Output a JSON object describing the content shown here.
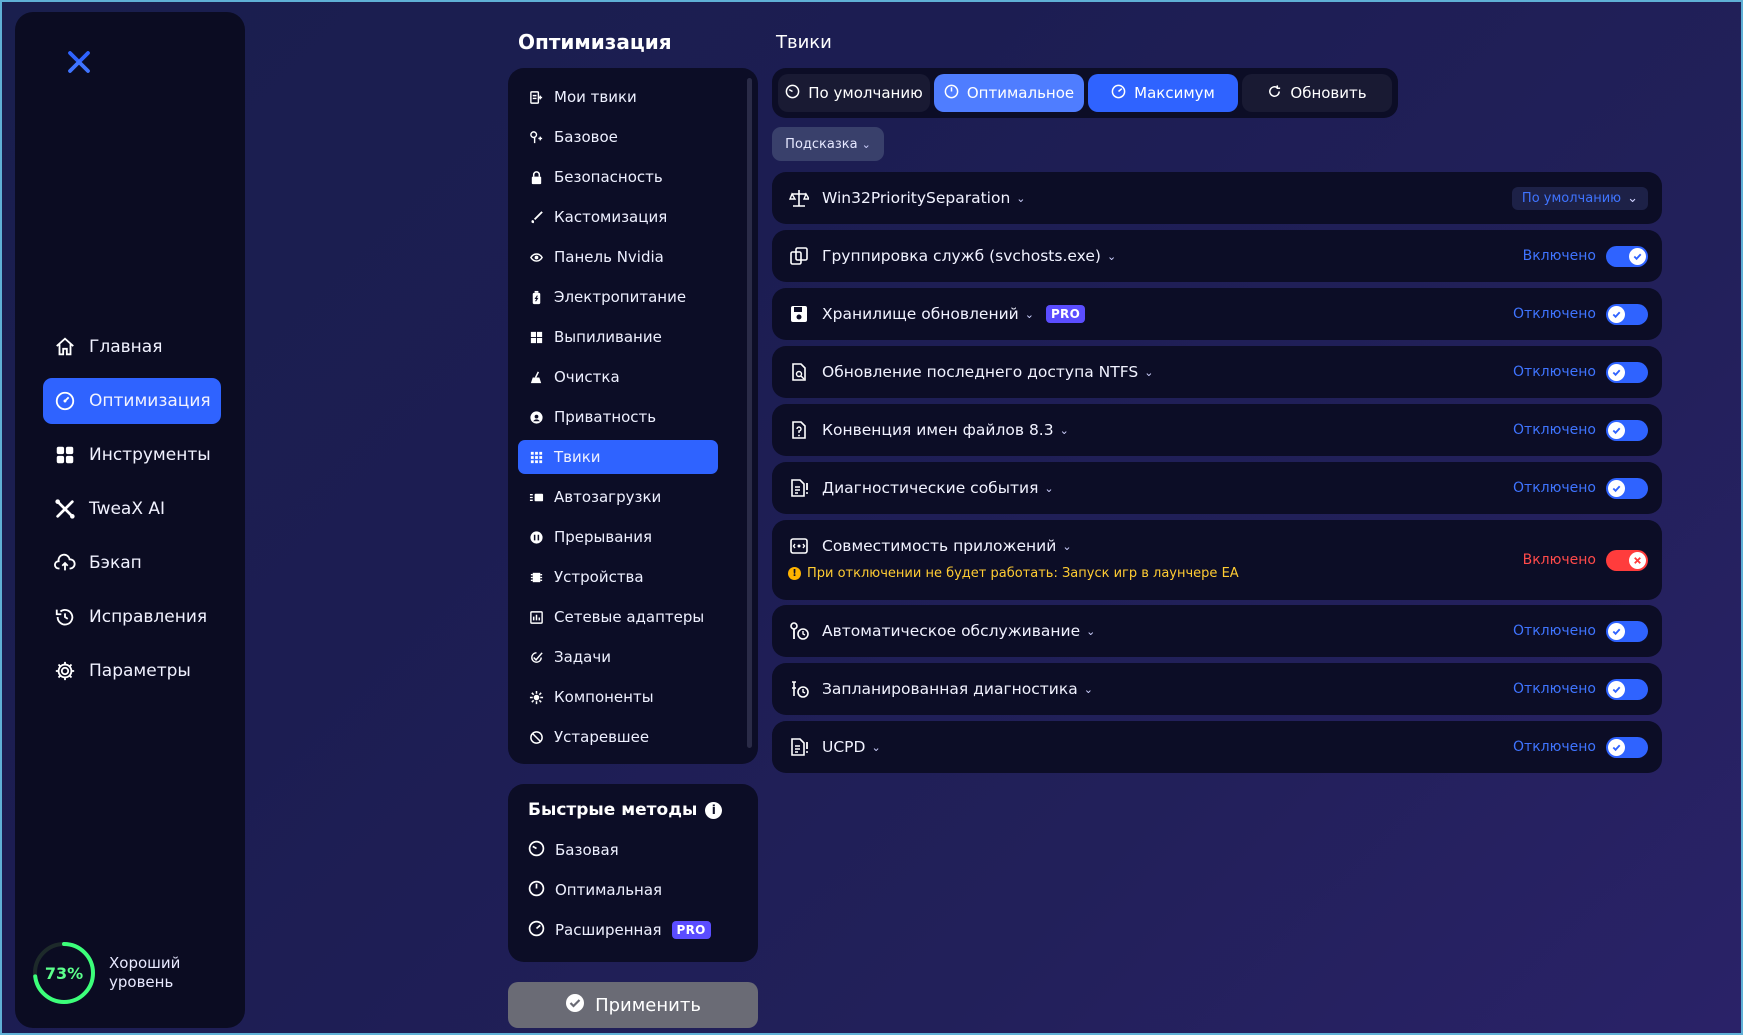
{
  "colors": {
    "accent": "#2f63ff",
    "accent_light": "#4f7dff",
    "panel": "#0c0d26",
    "status_blue": "#3f74ff",
    "status_red": "#ff4a4a",
    "level_green": "#5cff8c",
    "warning": "#ffcc33"
  },
  "sidebar": {
    "items": [
      {
        "label": "Главная",
        "icon": "home-icon"
      },
      {
        "label": "Оптимизация",
        "icon": "gauge-icon",
        "active": true
      },
      {
        "label": "Инструменты",
        "icon": "grid-icon"
      },
      {
        "label": "TweaX AI",
        "icon": "ai-icon"
      },
      {
        "label": "Бэкап",
        "icon": "cloud-upload-icon"
      },
      {
        "label": "Исправления",
        "icon": "history-icon"
      },
      {
        "label": "Параметры",
        "icon": "gear-icon"
      }
    ],
    "level": {
      "percent": "73%",
      "value": 0.73,
      "label": "Хороший уровень"
    }
  },
  "optimization": {
    "title": "Оптимизация",
    "menu": [
      {
        "label": "Мои твики",
        "icon": "my-tweaks-icon"
      },
      {
        "label": "Базовое",
        "icon": "wrench-icon"
      },
      {
        "label": "Безопасность",
        "icon": "lock-icon"
      },
      {
        "label": "Кастомизация",
        "icon": "brush-icon"
      },
      {
        "label": "Панель Nvidia",
        "icon": "nvidia-icon"
      },
      {
        "label": "Электропитание",
        "icon": "battery-icon"
      },
      {
        "label": "Выпиливание",
        "icon": "windows-icon"
      },
      {
        "label": "Очистка",
        "icon": "broom-icon"
      },
      {
        "label": "Приватность",
        "icon": "privacy-icon"
      },
      {
        "label": "Твики",
        "icon": "tweaks-grid-icon",
        "active": true
      },
      {
        "label": "Автозагрузки",
        "icon": "autostart-icon"
      },
      {
        "label": "Прерывания",
        "icon": "interrupt-icon"
      },
      {
        "label": "Устройства",
        "icon": "chip-icon"
      },
      {
        "label": "Сетевые адаптеры",
        "icon": "network-icon"
      },
      {
        "label": "Задачи",
        "icon": "tasks-icon"
      },
      {
        "label": "Компоненты",
        "icon": "components-icon"
      },
      {
        "label": "Устаревшее",
        "icon": "deprecated-icon"
      }
    ],
    "quick": {
      "title": "Быстрые методы",
      "items": [
        {
          "label": "Базовая",
          "icon": "gauge-low-icon"
        },
        {
          "label": "Оптимальная",
          "icon": "gauge-mid-icon"
        },
        {
          "label": "Расширенная",
          "icon": "gauge-high-icon",
          "pro": "PRO"
        }
      ]
    },
    "apply": "Применить"
  },
  "tweaks": {
    "title": "Твики",
    "presets": [
      {
        "label": "По умолчанию",
        "icon": "gauge-low-icon"
      },
      {
        "label": "Оптимальное",
        "icon": "gauge-mid-icon"
      },
      {
        "label": "Максимум",
        "icon": "gauge-high-icon"
      },
      {
        "label": "Обновить",
        "icon": "refresh-icon"
      }
    ],
    "hint": "Подсказка",
    "items": [
      {
        "label": "Win32PrioritySeparation",
        "icon": "scales-icon",
        "type": "select",
        "value": "По умолчанию"
      },
      {
        "label": "Группировка служб (svchosts.exe)",
        "icon": "group-icon",
        "status": "Включено",
        "state": "on"
      },
      {
        "label": "Хранилище обновлений",
        "icon": "save-icon",
        "status": "Отключено",
        "state": "off",
        "pro": "PRO"
      },
      {
        "label": "Обновление последнего доступа NTFS",
        "icon": "file-search-icon",
        "status": "Отключено",
        "state": "off"
      },
      {
        "label": "Конвенция имен файлов 8.3",
        "icon": "file-question-icon",
        "status": "Отключено",
        "state": "off"
      },
      {
        "label": "Диагностические события",
        "icon": "file-alert-icon",
        "status": "Отключено",
        "state": "off"
      },
      {
        "label": "Совместимость приложений",
        "icon": "compat-icon",
        "status": "Включено",
        "state": "red",
        "warning": "При отключении не будет работать: Запуск игр в лаунчере EA"
      },
      {
        "label": "Автоматическое обслуживание",
        "icon": "maintenance-icon",
        "status": "Отключено",
        "state": "off"
      },
      {
        "label": "Запланированная диагностика",
        "icon": "scheduled-diag-icon",
        "status": "Отключено",
        "state": "off"
      },
      {
        "label": "UCPD",
        "icon": "file-alert-icon",
        "status": "Отключено",
        "state": "off"
      }
    ]
  }
}
